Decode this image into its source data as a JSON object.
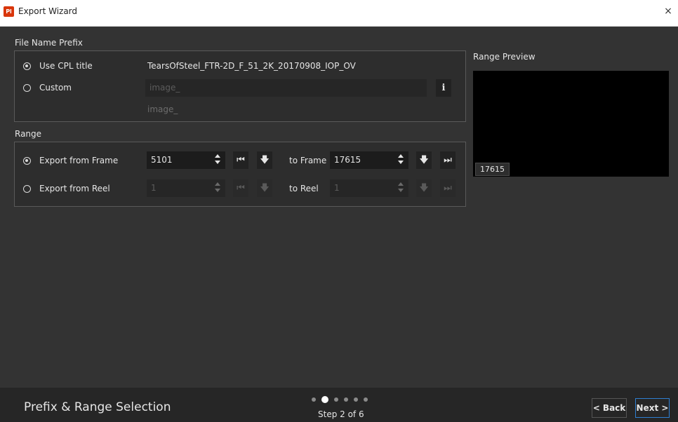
{
  "window": {
    "title": "Export Wizard",
    "app_icon_text": "Pl",
    "close_glyph": "×"
  },
  "file_name_prefix": {
    "section_label": "File Name Prefix",
    "use_cpl": {
      "label": "Use CPL title",
      "value": "TearsOfSteel_FTR-2D_F_51_2K_20170908_IOP_OV",
      "selected": true
    },
    "custom": {
      "label": "Custom",
      "input_value": "image_",
      "preview": "image_",
      "selected": false
    },
    "info_glyph": "i"
  },
  "range": {
    "section_label": "Range",
    "frame": {
      "label": "Export from Frame",
      "from_value": "5101",
      "to_label": "to Frame",
      "to_value": "17615",
      "selected": true
    },
    "reel": {
      "label": "Export from Reel",
      "from_value": "1",
      "to_label": "to Reel",
      "to_value": "1",
      "selected": false
    }
  },
  "preview": {
    "label": "Range Preview",
    "frame_badge": "17615"
  },
  "footer": {
    "step_title": "Prefix & Range Selection",
    "step_text": "Step 2 of 6",
    "total_steps": 6,
    "current_step": 2,
    "back_label": "< Back",
    "next_label": "Next >"
  },
  "colors": {
    "accent": "#2f7fd1",
    "app_icon": "#d9360b",
    "background": "#333333"
  },
  "icons": [
    "app-icon",
    "close-icon",
    "radio-icon",
    "info-icon",
    "spinner-icon",
    "skip-to-start-icon",
    "arrow-down-icon",
    "skip-to-end-icon"
  ]
}
